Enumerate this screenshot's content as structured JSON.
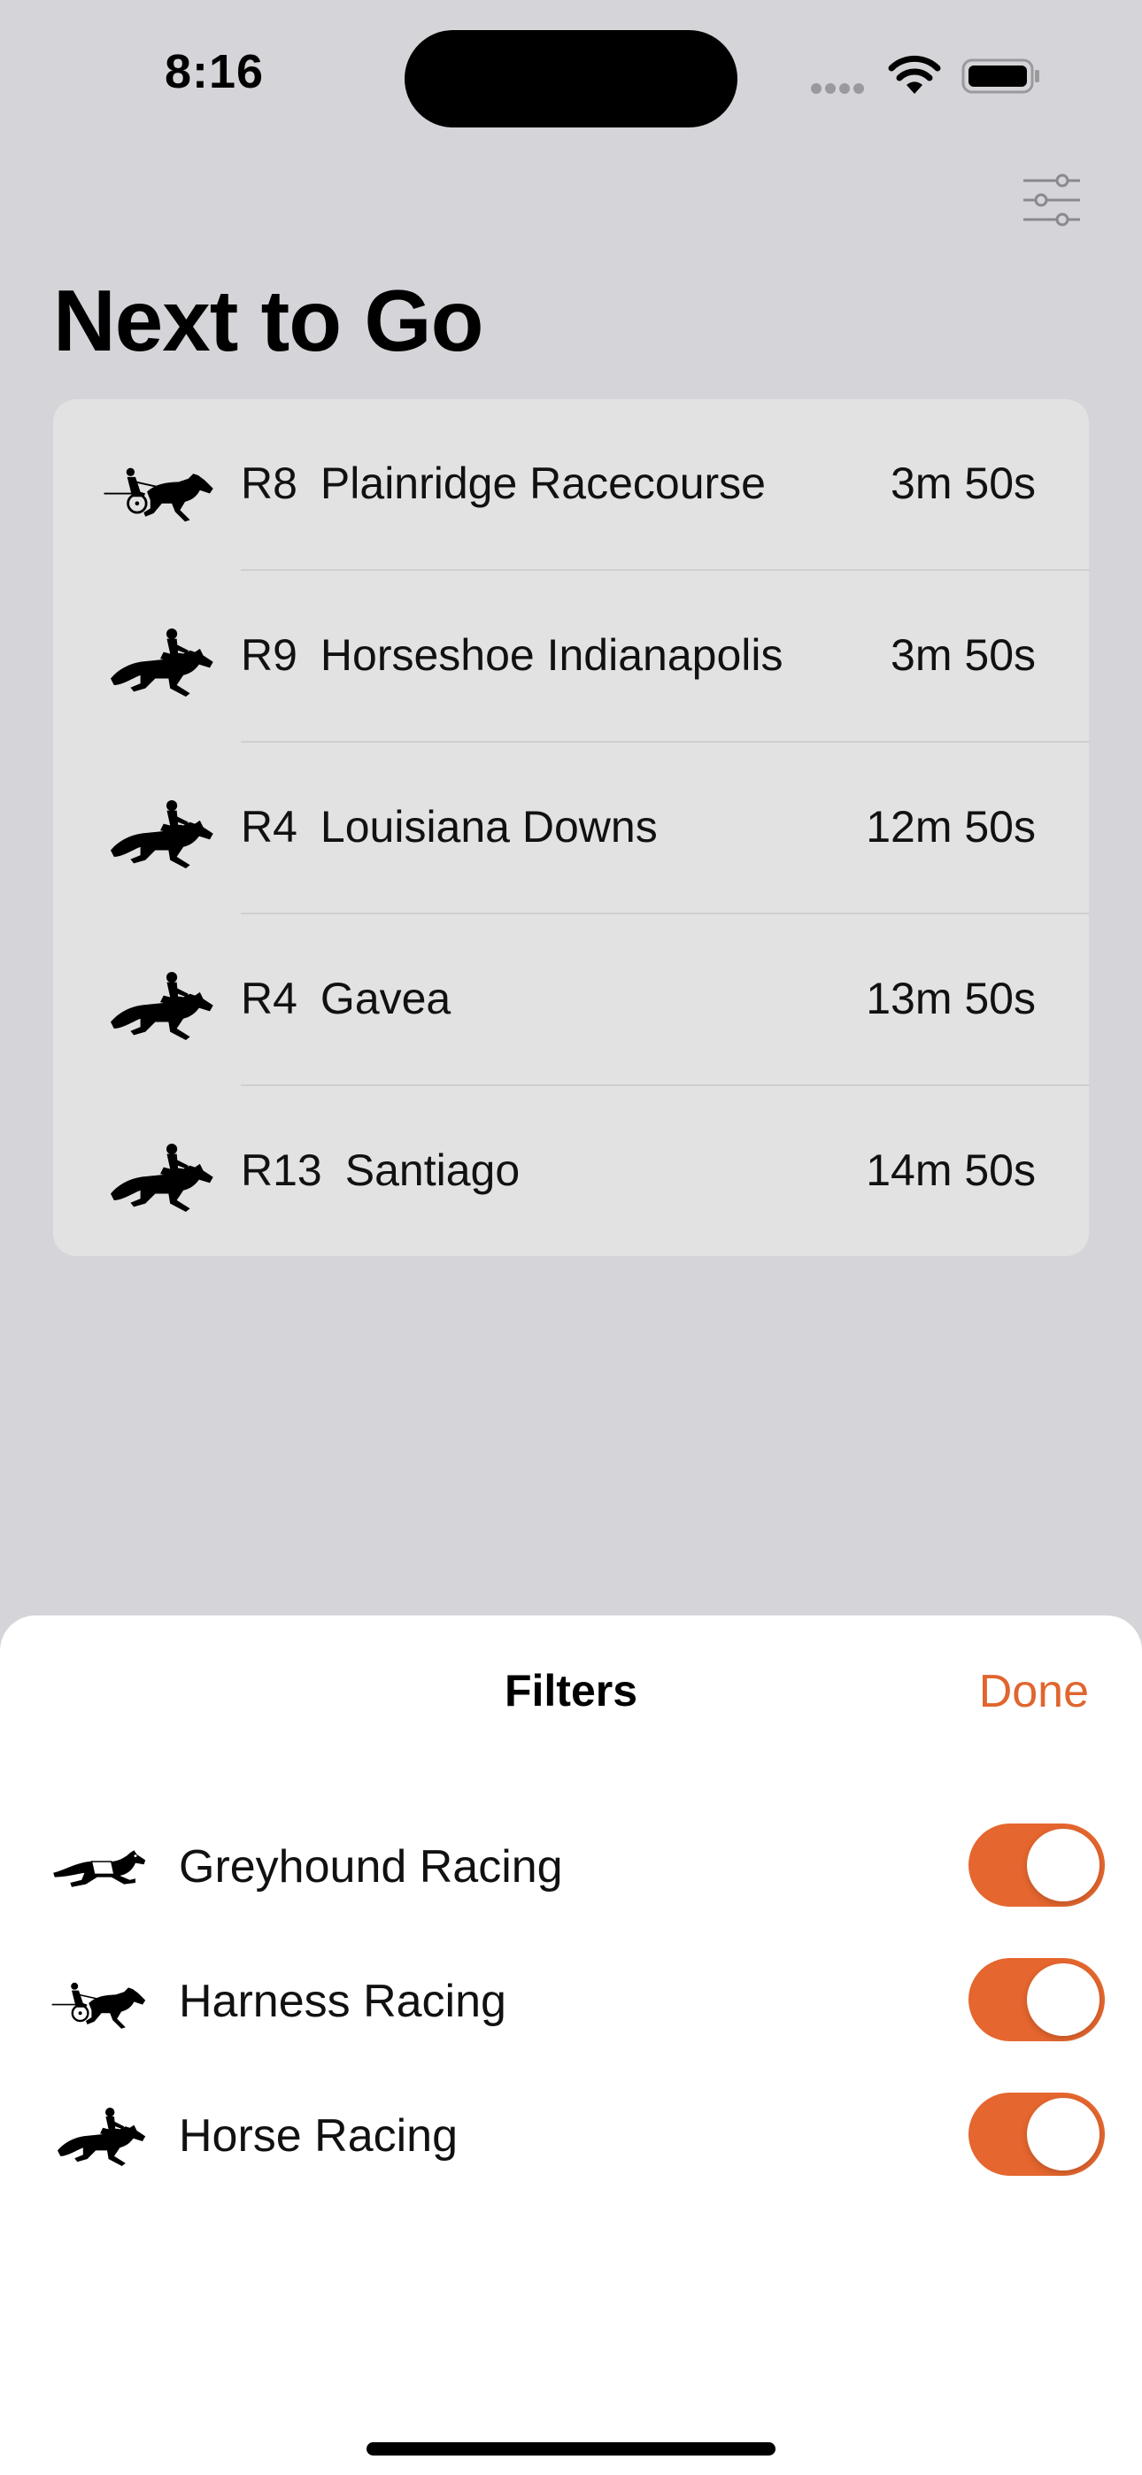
{
  "status_bar": {
    "time": "8:16"
  },
  "header": {
    "title": "Next to Go",
    "filter_icon": "sliders-icon"
  },
  "races": [
    {
      "icon": "harness-racing-icon",
      "race_number": "R8",
      "venue": "Plainridge Racecourse",
      "countdown": "3m 50s"
    },
    {
      "icon": "horse-racing-icon",
      "race_number": "R9",
      "venue": "Horseshoe Indianapolis",
      "countdown": "3m 50s"
    },
    {
      "icon": "horse-racing-icon",
      "race_number": "R4",
      "venue": "Louisiana Downs",
      "countdown": "12m 50s"
    },
    {
      "icon": "horse-racing-icon",
      "race_number": "R4",
      "venue": "Gavea",
      "countdown": "13m 50s"
    },
    {
      "icon": "horse-racing-icon",
      "race_number": "R13",
      "venue": "Santiago",
      "countdown": "14m 50s"
    }
  ],
  "filters_sheet": {
    "title": "Filters",
    "done_label": "Done",
    "accent_color": "#e5662e",
    "options": [
      {
        "icon": "greyhound-racing-icon",
        "label": "Greyhound Racing",
        "enabled": true
      },
      {
        "icon": "harness-racing-icon",
        "label": "Harness Racing",
        "enabled": true
      },
      {
        "icon": "horse-racing-icon",
        "label": "Horse Racing",
        "enabled": true
      }
    ]
  }
}
